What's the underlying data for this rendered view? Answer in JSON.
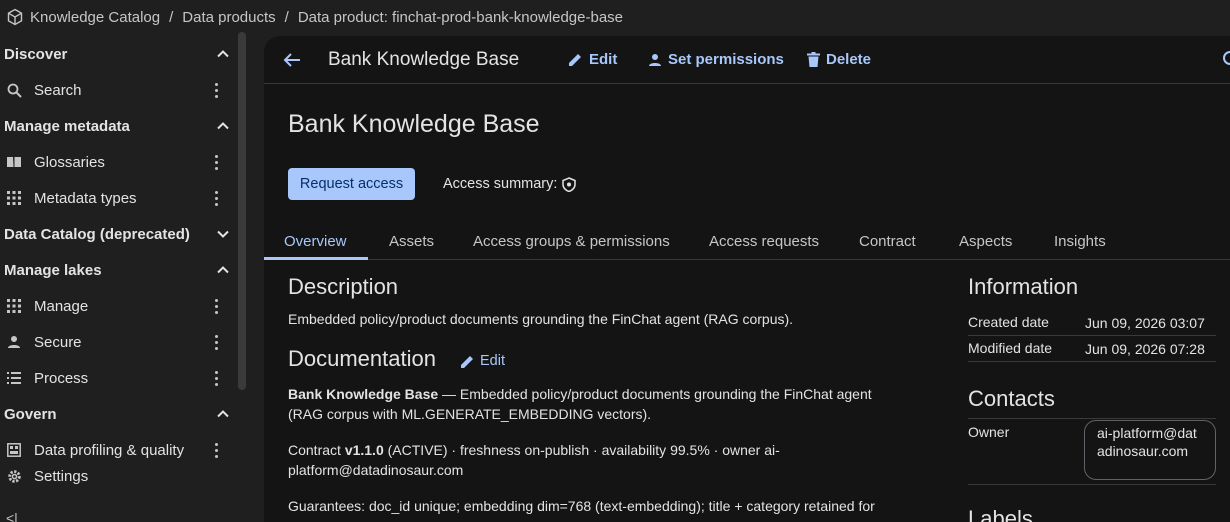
{
  "breadcrumb": {
    "items": [
      "Knowledge Catalog",
      "Data products",
      "Data product: finchat-prod-bank-knowledge-base"
    ],
    "separator": "/"
  },
  "sidebar": {
    "discover": "Discover",
    "search": "Search",
    "manage_metadata": "Manage metadata",
    "glossaries": "Glossaries",
    "metadata_types": "Metadata types",
    "data_catalog": "Data Catalog (deprecated)",
    "manage_lakes": "Manage lakes",
    "manage": "Manage",
    "secure": "Secure",
    "process": "Process",
    "govern": "Govern",
    "data_profiling": "Data profiling & quality",
    "settings": "Settings",
    "collapse": "<|"
  },
  "header": {
    "title": "Bank Knowledge Base",
    "edit": "Edit",
    "set_permissions": "Set permissions",
    "delete": "Delete"
  },
  "page": {
    "title": "Bank Knowledge Base",
    "request_access": "Request access",
    "access_summary": "Access summary:"
  },
  "tabs": [
    "Overview",
    "Assets",
    "Access groups & permissions",
    "Access requests",
    "Contract",
    "Aspects",
    "Insights"
  ],
  "description": {
    "heading": "Description",
    "text": "Embedded policy/product documents grounding the FinChat agent (RAG corpus)."
  },
  "documentation": {
    "heading": "Documentation",
    "edit": "Edit",
    "p1_bold": "Bank Knowledge Base",
    "p1_rest": " — Embedded policy/product documents grounding the FinChat agent (RAG corpus with ML.GENERATE_EMBEDDING vectors).",
    "p2_pre": "Contract ",
    "p2_bold": "v1.1.0",
    "p2_rest": " (ACTIVE) · freshness on-publish · availability 99.5% · owner ai-platform@datadinosaur.com",
    "p3": "Guarantees: doc_id unique; embedding dim=768 (text-embedding); title + category retained for"
  },
  "information": {
    "heading": "Information",
    "created_label": "Created date",
    "created_value": "Jun 09, 2026 03:07",
    "modified_label": "Modified date",
    "modified_value": "Jun 09, 2026 07:28"
  },
  "contacts": {
    "heading": "Contacts",
    "owner_label": "Owner",
    "owner_value": "ai-platform@datadinosaur.com"
  },
  "labels": {
    "heading": "Labels"
  },
  "colors": {
    "accent": "#a8c7fa",
    "background": "#1f1f1f",
    "panel": "#141414"
  }
}
